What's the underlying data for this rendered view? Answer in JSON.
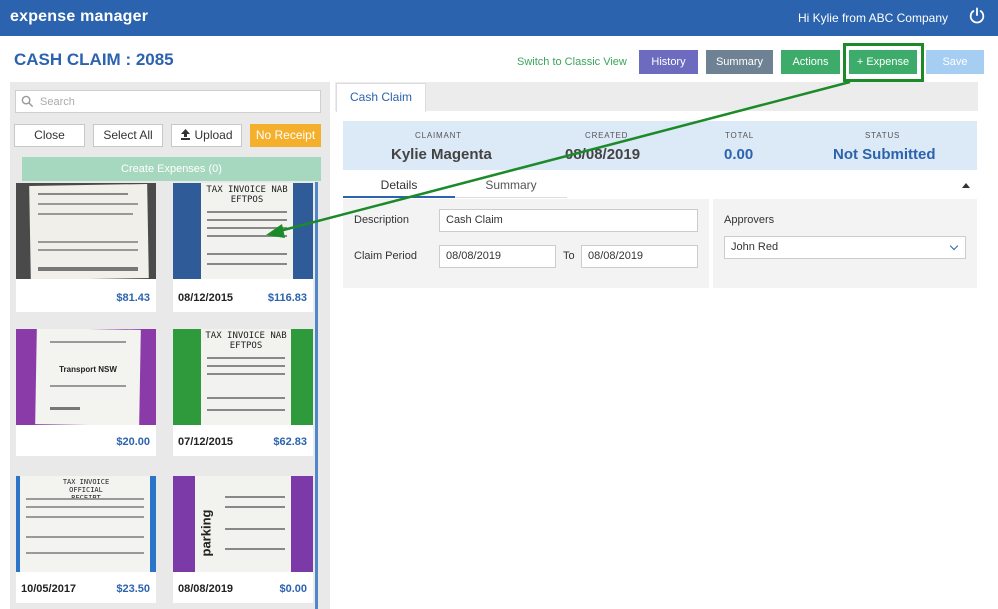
{
  "header": {
    "logo": "expense manager",
    "greeting": "Hi Kylie from ABC Company"
  },
  "page": {
    "title": "CASH CLAIM : 2085"
  },
  "toolbar": {
    "classic_view": "Switch to Classic View",
    "history": "History",
    "summary": "Summary",
    "actions": "Actions",
    "expense": "+ Expense",
    "save": "Save"
  },
  "left": {
    "search_placeholder": "Search",
    "close": "Close",
    "select_all": "Select All",
    "upload": "Upload",
    "no_receipt": "No Receipt",
    "create_expenses": "Create Expenses (0)",
    "receipts": [
      {
        "date": "",
        "amount": "$81.43",
        "img_header": "",
        "img_color": "#4a4a4a"
      },
      {
        "date": "08/12/2015",
        "amount": "$116.83",
        "img_header": "TAX INVOICE NAB EFTPOS",
        "img_color": "#2f5c98"
      },
      {
        "date": "",
        "amount": "$20.00",
        "img_header": "Transport NSW",
        "img_color": "#8b3ba8"
      },
      {
        "date": "07/12/2015",
        "amount": "$62.83",
        "img_header": "TAX INVOICE NAB EFTPOS",
        "img_color": "#2e9a3b"
      },
      {
        "date": "10/05/2017",
        "amount": "$23.50",
        "img_header": "TAX INVOICE OFFICIAL RECEIPT",
        "img_color": "#2c74c8"
      },
      {
        "date": "08/08/2019",
        "amount": "$0.00",
        "img_header": "parking",
        "img_color": "#7b3aa8"
      }
    ]
  },
  "tabs": {
    "cash_claim": "Cash Claim"
  },
  "info": {
    "claimant_label": "Claimant",
    "claimant": "Kylie Magenta",
    "created_label": "Created",
    "created": "08/08/2019",
    "total_label": "Total",
    "total": "0.00",
    "status_label": "Status",
    "status": "Not Submitted"
  },
  "subtabs": {
    "details": "Details",
    "summary": "Summary"
  },
  "form": {
    "description_label": "Description",
    "description": "Cash Claim",
    "period_label": "Claim Period",
    "period_from": "08/08/2019",
    "to_label": "To",
    "period_to": "08/08/2019",
    "approvers_label": "Approvers",
    "approver": "John Red"
  },
  "colors": {
    "brand": "#2c63ae",
    "accent_green": "#3dab6a",
    "highlight": "#1c8a28"
  }
}
